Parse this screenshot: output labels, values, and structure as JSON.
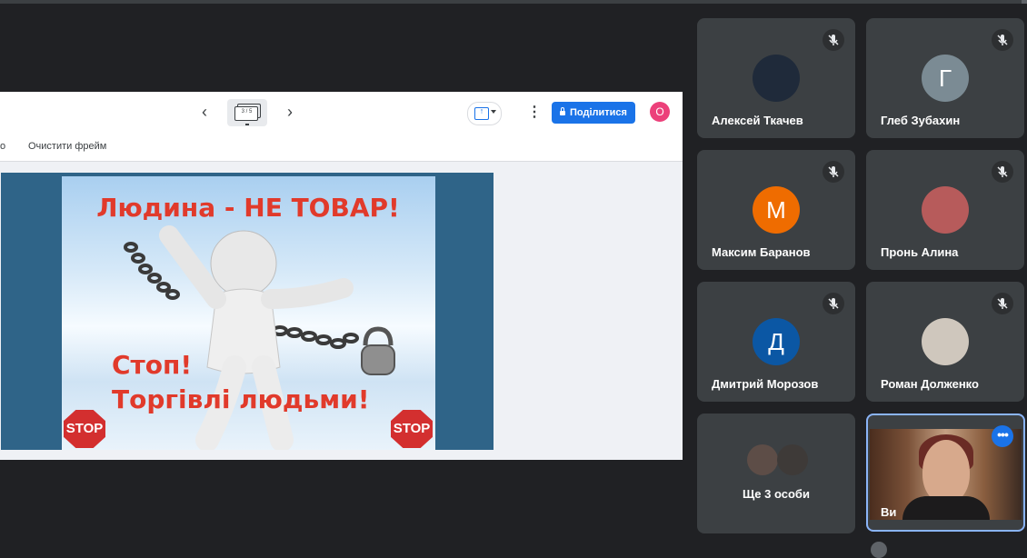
{
  "toolbar": {
    "frame_counter": "3 / 5",
    "share_label": "Поділитися",
    "user_initial": "О",
    "clear_frame_label": "Очистити фрейм",
    "subbar_cut_text": "о"
  },
  "slide": {
    "title": "Людина - НЕ ТОВАР!",
    "line1": "Стоп!",
    "line2": "Торгівлі людьми!",
    "stop_sign_text": "STOP"
  },
  "participants": [
    {
      "name": "Алексей Ткачев",
      "initial": "",
      "avatar_color": "#1f2a3a",
      "muted": true
    },
    {
      "name": "Глеб Зубахин",
      "initial": "Г",
      "avatar_color": "#7b8b94",
      "muted": true
    },
    {
      "name": "Максим Баранов",
      "initial": "М",
      "avatar_color": "#ef6c00",
      "muted": true
    },
    {
      "name": "Пронь Алина",
      "initial": "",
      "avatar_color": "#b75b5b",
      "muted": true
    },
    {
      "name": "Дмитрий Морозов",
      "initial": "Д",
      "avatar_color": "#0b57a4",
      "muted": true
    },
    {
      "name": "Роман Долженко",
      "initial": "",
      "avatar_color": "#cfc7bd",
      "muted": true
    }
  ],
  "more_tile": {
    "label": "Ще 3 особи"
  },
  "self_tile": {
    "label": "Ви"
  }
}
